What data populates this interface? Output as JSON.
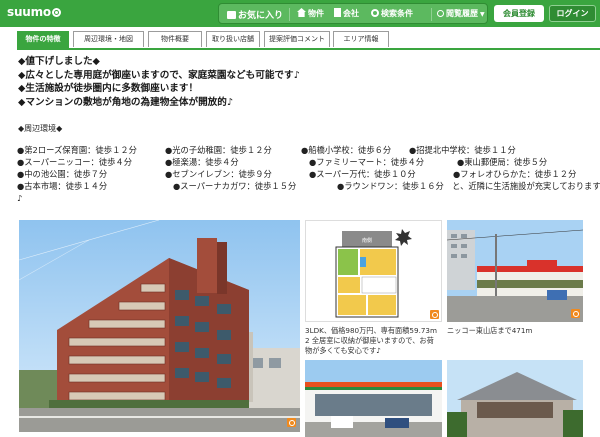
{
  "header": {
    "logo": "suumo",
    "nav": [
      {
        "label": "お気に入り",
        "icon": "heart-list-icon"
      },
      {
        "label": "物件",
        "icon": "house-icon"
      },
      {
        "label": "会社",
        "icon": "building-icon"
      },
      {
        "label": "検索条件",
        "icon": "search-icon"
      },
      {
        "label": "閲覧履歴",
        "icon": "history-icon"
      }
    ],
    "register_label": "会員登録",
    "login_label": "ログイン"
  },
  "tabs": [
    {
      "label": "物件の特徴",
      "active": true
    },
    {
      "label": "周辺環境・地図",
      "active": false
    },
    {
      "label": "物件概要",
      "active": false
    },
    {
      "label": "取り扱い店舗",
      "active": false
    },
    {
      "label": "提案評価コメント",
      "active": false
    },
    {
      "label": "エリア情報",
      "active": false
    }
  ],
  "copy": [
    "◆値下げしました◆",
    "◆広々とした専用庭が御座いますので、家庭菜園なども可能です♪",
    "◆生活施設が徒歩圏内に多数御座います！",
    "◆マンションの敷地が角地の為建物全体が開放的♪"
  ],
  "environment": {
    "heading": "◆周辺環境◆",
    "rows": [
      [
        "●第2ローズ保育園：徒歩１２分",
        "●光の子幼稚園：徒歩１２分",
        "●船橋小学校：徒歩６分",
        "●招提北中学校：徒歩１１分"
      ],
      [
        "●スーパーニッコー：徒歩４分",
        "●極楽湯：徒歩４分",
        "●ファミリーマート：徒歩４分",
        "●東山郵便局：徒歩５分"
      ],
      [
        "●中の池公園：徒歩７分",
        "●セブンイレブン：徒歩９分",
        "●スーパー万代：徒歩１０分",
        "●フォレオひらかた：徒歩１２分"
      ],
      [
        "●古本市場：徒歩１４分",
        "●スーパーナカガワ：徒歩１５分",
        "●ラウンドワン：徒歩１６分　と、近隣に生活施設が充実しております"
      ],
      [
        "♪"
      ]
    ]
  },
  "photos": {
    "floorplan_caption": [
      "3LDK、価格980万円、専有面積59.73m",
      "2 全居室に収納が御座いますので、お荷",
      "物が多くても安心です♪"
    ],
    "store_caption": "ニッコー東山店まで471m",
    "floorplan_label": "南側"
  },
  "colors": {
    "brand_green": "#3aa53f",
    "zoom_orange": "#f08a1e"
  }
}
